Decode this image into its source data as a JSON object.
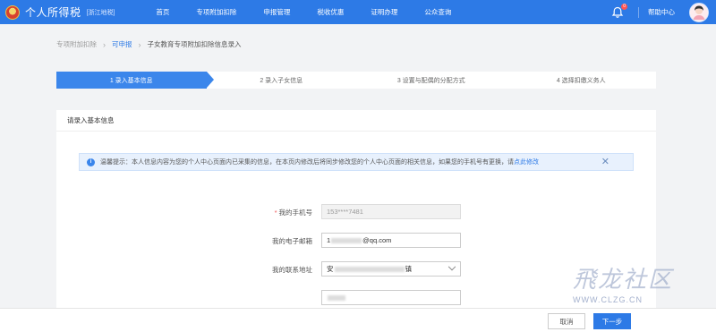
{
  "header": {
    "app_title": "个人所得税",
    "region": "浙江地税",
    "nav": [
      "首页",
      "专项附加扣除",
      "申报管理",
      "税收优惠",
      "证明办理",
      "公众查询"
    ],
    "notification_count": "0",
    "help_label": "帮助中心"
  },
  "breadcrumb": {
    "items": [
      "专项附加扣除",
      "可申报",
      "子女教育专项附加扣除信息录入"
    ]
  },
  "steps": [
    {
      "label": "1 录入基本信息",
      "active": true
    },
    {
      "label": "2 录入子女信息",
      "active": false
    },
    {
      "label": "3 设置与配偶的分配方式",
      "active": false
    },
    {
      "label": "4 选择扣缴义务人",
      "active": false
    }
  ],
  "panel": {
    "title": "请录入基本信息",
    "notice": {
      "prefix": "温馨提示：本人信息内容为您的个人中心页面内已采集的信息，在本页内修改后将同步修改您的个人中心页面的相关信息，如果您的手机号有更换，请",
      "link": "点此修改",
      "close": "✕"
    },
    "fields": {
      "phone_label": "我的手机号",
      "phone_value": "153****7481",
      "email_label": "我的电子邮箱",
      "email_prefix": "1",
      "email_suffix": "@qq.com",
      "address_label": "我的联系地址",
      "address_prefix": "安",
      "address_suffix": "镇"
    }
  },
  "footer": {
    "cancel_label": "取消",
    "next_label": "下一步"
  },
  "watermark": {
    "text": "飛龙社区",
    "url": "WWW.CLZG.CN"
  }
}
